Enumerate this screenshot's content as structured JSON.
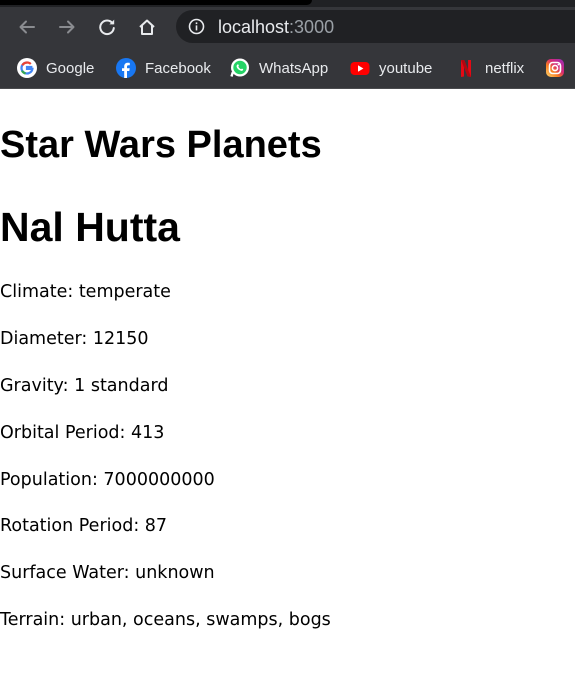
{
  "browser": {
    "url_host": "localhost",
    "url_port": ":3000",
    "bookmarks": [
      {
        "label": "Google",
        "icon": "google-icon"
      },
      {
        "label": "Facebook",
        "icon": "facebook-icon"
      },
      {
        "label": "WhatsApp",
        "icon": "whatsapp-icon"
      },
      {
        "label": "youtube",
        "icon": "youtube-icon"
      },
      {
        "label": "netflix",
        "icon": "netflix-icon"
      },
      {
        "label": "",
        "icon": "instagram-icon"
      }
    ]
  },
  "page": {
    "title": "Star Wars Planets",
    "planet": {
      "name": "Nal Hutta",
      "attributes": [
        {
          "label": "Climate",
          "value": "temperate"
        },
        {
          "label": "Diameter",
          "value": "12150"
        },
        {
          "label": "Gravity",
          "value": "1 standard"
        },
        {
          "label": "Orbital Period",
          "value": "413"
        },
        {
          "label": "Population",
          "value": "7000000000"
        },
        {
          "label": "Rotation Period",
          "value": "87"
        },
        {
          "label": "Surface Water",
          "value": "unknown"
        },
        {
          "label": "Terrain",
          "value": "urban, oceans, swamps, bogs"
        }
      ]
    }
  },
  "colors": {
    "chrome_toolbar": "#35363a",
    "chrome_omnibox": "#202124",
    "chrome_text": "#e8eaed",
    "page_background": "#ffffff",
    "page_text": "#000000"
  }
}
